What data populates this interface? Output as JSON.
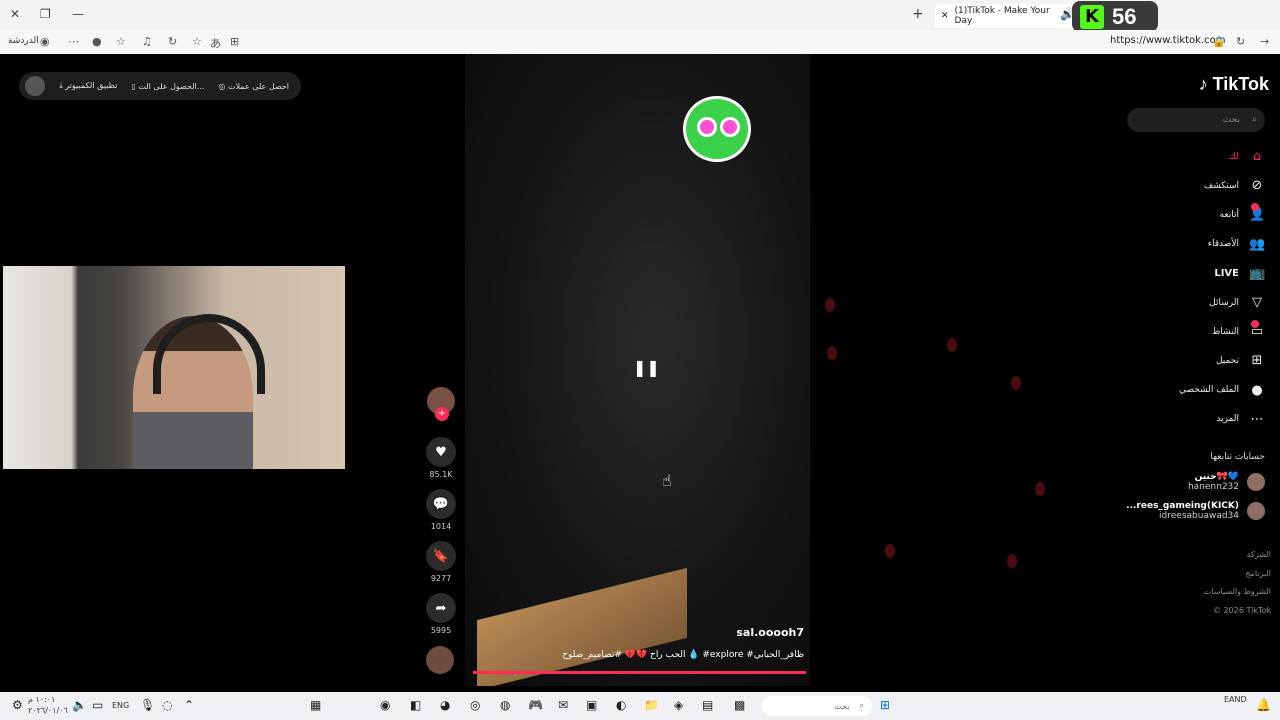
{
  "browser": {
    "tab_title": "(1)TikTok - Make Your Day",
    "url": "https://www.tiktok.com",
    "chat_label": "الدردشة",
    "kick_count": "56"
  },
  "topbar": {
    "item1": "احصل على عملات",
    "item2": "الحصول على الت...",
    "item3": "تطبيق الكمبيوتر"
  },
  "video": {
    "creator": "sal.ooooh7",
    "caption": "الحب راح 💔💔 #تصاميم_صلوح 💧 #explore #ظافر_الحبابي"
  },
  "actions": {
    "likes": "85.1K",
    "comments": "1014",
    "saves": "9277",
    "shares": "5995"
  },
  "sidebar": {
    "logo": "TikTok",
    "search_placeholder": "بحث",
    "nav": {
      "foryou": "لك",
      "explore": "استكشف",
      "following": "أتابعه",
      "friends": "الأصدقاء",
      "live": "LIVE",
      "messages": "الرسائل",
      "activity": "النشاط",
      "upload": "تحميل",
      "profile": "الملف الشخصي",
      "more": "المزيد"
    },
    "following_header": "حسابات تتابعها",
    "following_accounts": [
      {
        "display": "حنين🎀💙",
        "handle": "hanenn232"
      },
      {
        "display": "...rees_gameing(KICK)",
        "handle": "idreesabuawad34"
      }
    ],
    "footer": [
      "الشركة",
      "البرنامج",
      "الشروط والسياسات",
      "© 2026 TikTok"
    ]
  },
  "taskbar": {
    "search": "بحث",
    "lang": "ENG",
    "time": "١٠:٠١ م",
    "date": "٢٠٢٦/٠١/٠٦",
    "input_lang": "EAND"
  }
}
